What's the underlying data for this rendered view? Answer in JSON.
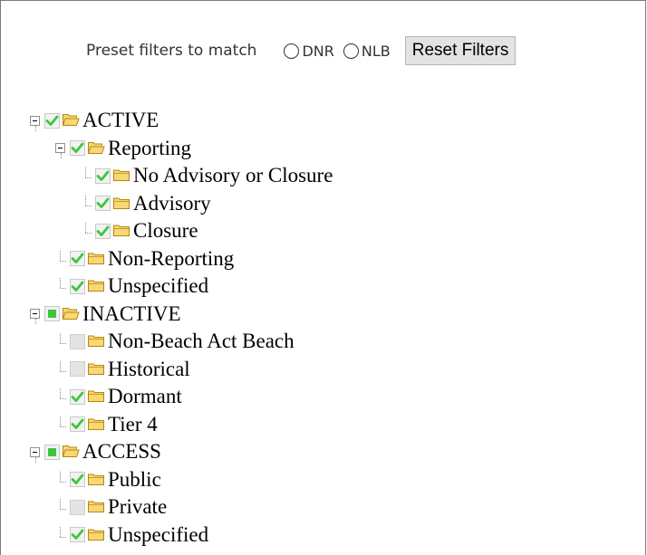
{
  "preset": {
    "label": "Preset filters to match",
    "options": [
      {
        "label": "DNR",
        "selected": false
      },
      {
        "label": "NLB",
        "selected": false
      }
    ],
    "reset_label": "Reset Filters"
  },
  "tree": [
    {
      "label": "ACTIVE",
      "level": 0,
      "state": "checked",
      "expanded": true
    },
    {
      "label": "Reporting",
      "level": 1,
      "state": "checked",
      "expanded": true
    },
    {
      "label": "No Advisory or Closure",
      "level": 2,
      "state": "checked"
    },
    {
      "label": "Advisory",
      "level": 2,
      "state": "checked"
    },
    {
      "label": "Closure",
      "level": 2,
      "state": "checked"
    },
    {
      "label": "Non-Reporting",
      "level": 1,
      "state": "checked"
    },
    {
      "label": "Unspecified",
      "level": 1,
      "state": "checked"
    },
    {
      "label": "INACTIVE",
      "level": 0,
      "state": "partial",
      "expanded": true
    },
    {
      "label": "Non-Beach Act Beach",
      "level": 1,
      "state": "unchecked"
    },
    {
      "label": "Historical",
      "level": 1,
      "state": "unchecked"
    },
    {
      "label": "Dormant",
      "level": 1,
      "state": "checked"
    },
    {
      "label": "Tier 4",
      "level": 1,
      "state": "checked"
    },
    {
      "label": "ACCESS",
      "level": 0,
      "state": "partial",
      "expanded": true
    },
    {
      "label": "Public",
      "level": 1,
      "state": "checked"
    },
    {
      "label": "Private",
      "level": 1,
      "state": "unchecked"
    },
    {
      "label": "Unspecified",
      "level": 1,
      "state": "checked"
    }
  ],
  "colors": {
    "check_green": "#3ec53e",
    "folder_fill": "#f8d775",
    "folder_stroke": "#b8860b"
  },
  "icons": {
    "expander": "collapse-minus-icon",
    "folder": "folder-icon",
    "checkbox": "checkbox-icon"
  }
}
